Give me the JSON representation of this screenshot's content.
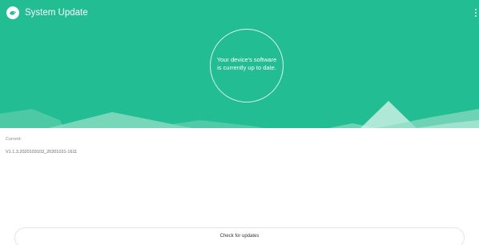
{
  "app_bar": {
    "title": "System Update",
    "logo_icon": "app-logo-icon",
    "menu_icon": "more-vertical-icon"
  },
  "status": {
    "line1": "Your device's software",
    "line2": "is currently up to date."
  },
  "info": {
    "current_label": "Current:",
    "version": "V1.1.3.2020103103_20201031-1611"
  },
  "actions": {
    "check_label": "Check for updates"
  },
  "colors": {
    "accent": "#22bd92",
    "mountain_light": "#6fd4b5",
    "mountain_pale": "#a8e6d2",
    "background": "#ffffff"
  }
}
